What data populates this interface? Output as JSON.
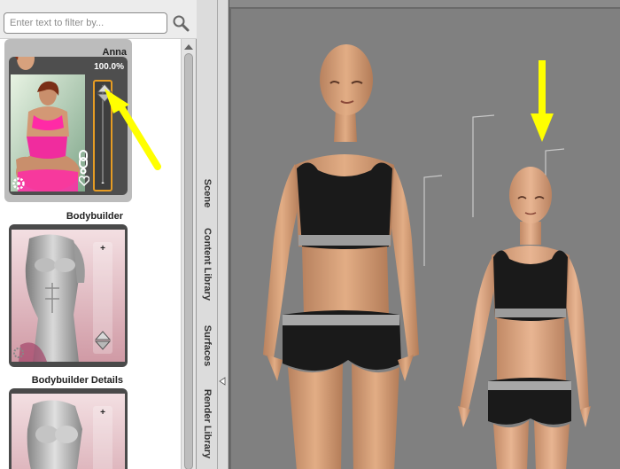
{
  "filter": {
    "placeholder": "Enter text to filter by...",
    "value": ""
  },
  "search_icon": "magnifier-icon",
  "morphs": [
    {
      "name": "Anna",
      "percent": "100.0%",
      "selected": true
    },
    {
      "name": "Bodybuilder"
    },
    {
      "name": "Bodybuilder Details"
    }
  ],
  "card_icons": [
    "gear-icon",
    "link-icon",
    "heart-icon"
  ],
  "slider_labels": {
    "plus": "+",
    "minus": "-"
  },
  "tabs": [
    "Scene",
    "Content Library",
    "Surfaces",
    "Render Library"
  ],
  "colors": {
    "accent_orange": "#e69c24",
    "annotation_yellow": "#ffff00",
    "panel_bg": "#ffffff",
    "viewport_bg": "#808080"
  }
}
